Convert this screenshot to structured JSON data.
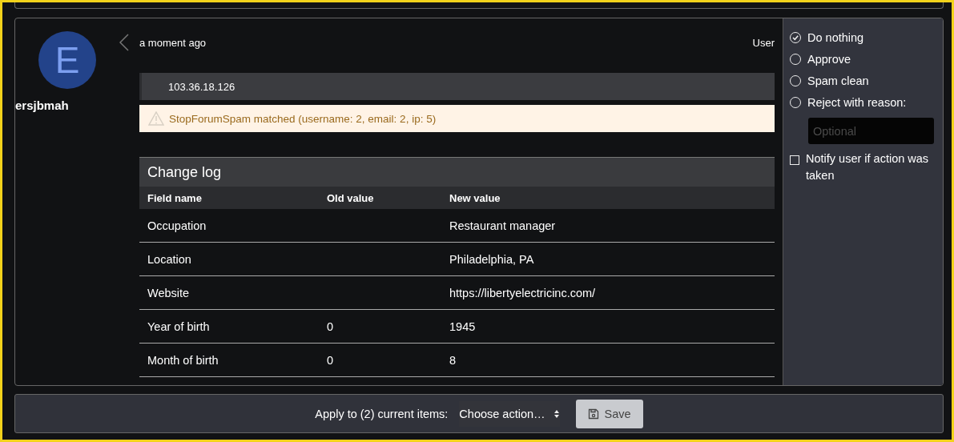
{
  "user": {
    "avatar_letter": "E",
    "username": "ersjbmah"
  },
  "item": {
    "time": "a moment ago",
    "content_type": "User",
    "ip": "103.36.18.126",
    "warning": "StopForumSpam matched (username: 2, email: 2, ip: 5)"
  },
  "change_log": {
    "title": "Change log",
    "columns": [
      "Field name",
      "Old value",
      "New value"
    ],
    "rows": [
      [
        "Occupation",
        "",
        "Restaurant manager"
      ],
      [
        "Location",
        "",
        "Philadelphia, PA"
      ],
      [
        "Website",
        "",
        "https://libertyelectricinc.com/"
      ],
      [
        "Year of birth",
        "0",
        "1945"
      ],
      [
        "Month of birth",
        "0",
        "8"
      ]
    ]
  },
  "actions": {
    "options": [
      {
        "label": "Do nothing",
        "selected": true
      },
      {
        "label": "Approve",
        "selected": false
      },
      {
        "label": "Spam clean",
        "selected": false
      },
      {
        "label": "Reject with reason:",
        "selected": false
      }
    ],
    "reason": {
      "placeholder": "Optional"
    },
    "notify": {
      "label": "Notify user if action was taken",
      "checked": false
    }
  },
  "footer": {
    "label": "Apply to (2) current items:",
    "select": "Choose action…",
    "save": "Save"
  }
}
